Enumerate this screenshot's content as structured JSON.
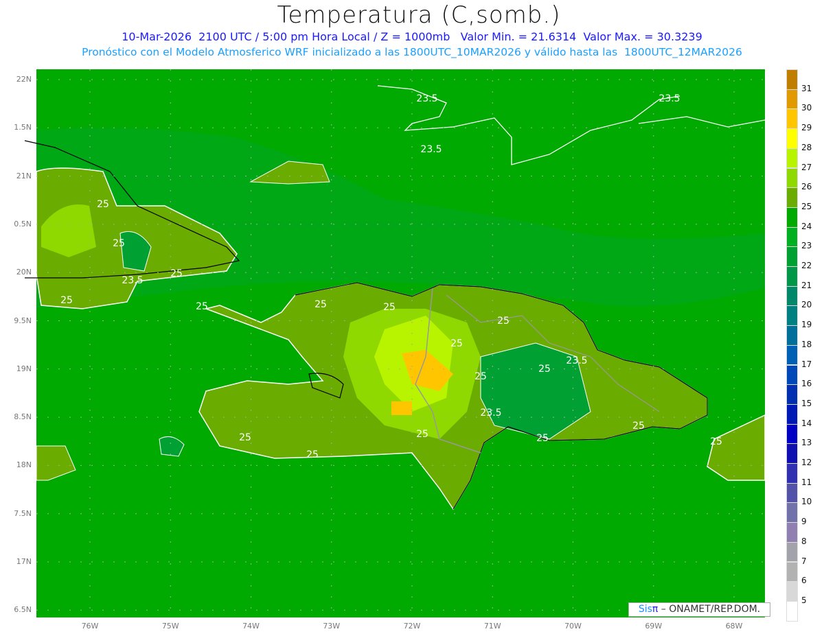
{
  "header": {
    "title": "Temperatura (C,somb.)",
    "subtitle": "10-Mar-2026  2100 UTC / 5:00 pm Hora Local / Z = 1000mb   Valor Min. = 21.6314  Valor Max. = 30.3239",
    "forecast_note": "Pronóstico con el Modelo Atmosferico WRF inicializado a las 1800UTC_10MAR2026 y válido hasta las  1800UTC_12MAR2026"
  },
  "axes": {
    "lat_labels": [
      "22N",
      "1.5N",
      "21N",
      "0.5N",
      "20N",
      "9.5N",
      "19N",
      "8.5N",
      "18N",
      "7.5N",
      "17N",
      "6.5N"
    ],
    "lon_labels": [
      "76W",
      "75W",
      "74W",
      "73W",
      "72W",
      "71W",
      "70W",
      "69W",
      "68W"
    ]
  },
  "contour_labels": [
    "23.5",
    "23.5",
    "23.5",
    "25",
    "25",
    "23.5",
    "25",
    "25",
    "25",
    "25",
    "25",
    "25",
    "25",
    "25",
    "23.5",
    "25",
    "23.5",
    "25",
    "25",
    "25",
    "25",
    "25",
    "25"
  ],
  "colorbar": {
    "labels": [
      "31",
      "30",
      "29",
      "28",
      "27",
      "26",
      "25",
      "24",
      "23",
      "22",
      "21",
      "20",
      "19",
      "18",
      "17",
      "16",
      "15",
      "14",
      "13",
      "12",
      "11",
      "10",
      "9",
      "8",
      "7",
      "6",
      "5"
    ],
    "colors": [
      "#c07e00",
      "#e09a00",
      "#ffc600",
      "#ffff00",
      "#b8f400",
      "#8fd800",
      "#6aac00",
      "#00aa00",
      "#00b020",
      "#00a032",
      "#009848",
      "#008868",
      "#008080",
      "#00709a",
      "#0060b4",
      "#0048b8",
      "#0030b0",
      "#0018b4",
      "#0000c4",
      "#1010b0",
      "#3030b0",
      "#5252a8",
      "#7272aa",
      "#9080b2",
      "#a2a2aa",
      "#b2b2b2",
      "#d8d8d8",
      "#ffffff"
    ]
  },
  "logo": {
    "sis": "Sis",
    "pi": "π",
    "rest": " – ONAMET/REP.DOM."
  },
  "colors": {
    "ocean": "#00aa00",
    "land_warm": "#6aac00",
    "land_hot": "#ffc600",
    "contour": "#ffffff",
    "coast": "#000000",
    "border": "#999999"
  }
}
